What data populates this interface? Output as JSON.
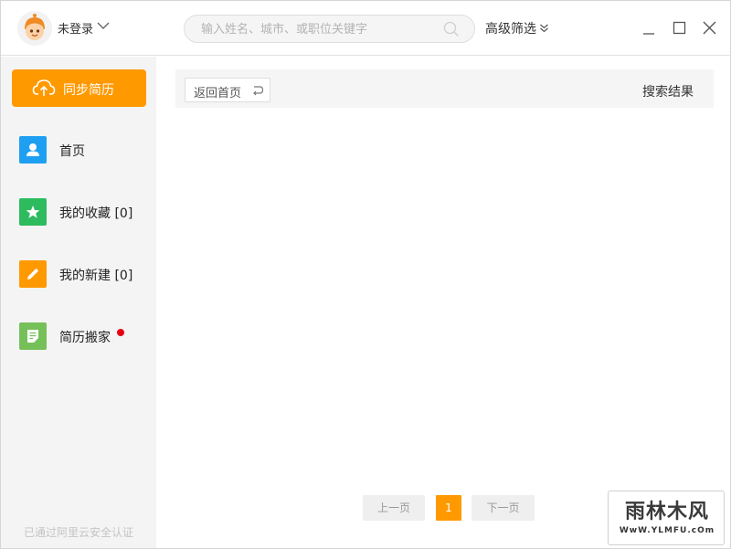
{
  "header": {
    "user_label": "未登录",
    "search_placeholder": "输入姓名、城市、或职位关键字",
    "advanced_filter": "高级筛选"
  },
  "sidebar": {
    "sync_button": "同步简历",
    "items": [
      {
        "label": "首页",
        "icon": "person-icon",
        "color": "#1e9ff2"
      },
      {
        "label": "我的收藏 [0]",
        "icon": "star-icon",
        "color": "#2dbb5e"
      },
      {
        "label": "我的新建 [0]",
        "icon": "pencil-icon",
        "color": "#ff9900"
      },
      {
        "label": "简历搬家",
        "icon": "document-icon",
        "color": "#76c05a",
        "badge": "red-dot"
      }
    ],
    "footer_note": "已通过阿里云安全认证"
  },
  "main": {
    "back_button": "返回首页",
    "results_title": "搜索结果",
    "pager": {
      "prev": "上一页",
      "current": "1",
      "next": "下一页"
    }
  },
  "watermark": {
    "text": "雨林木风",
    "url": "WwW.YLMFU.cOm"
  },
  "colors": {
    "accent": "#ff9900",
    "sidebar_bg": "#f4f4f4",
    "badge": "#e60012"
  }
}
